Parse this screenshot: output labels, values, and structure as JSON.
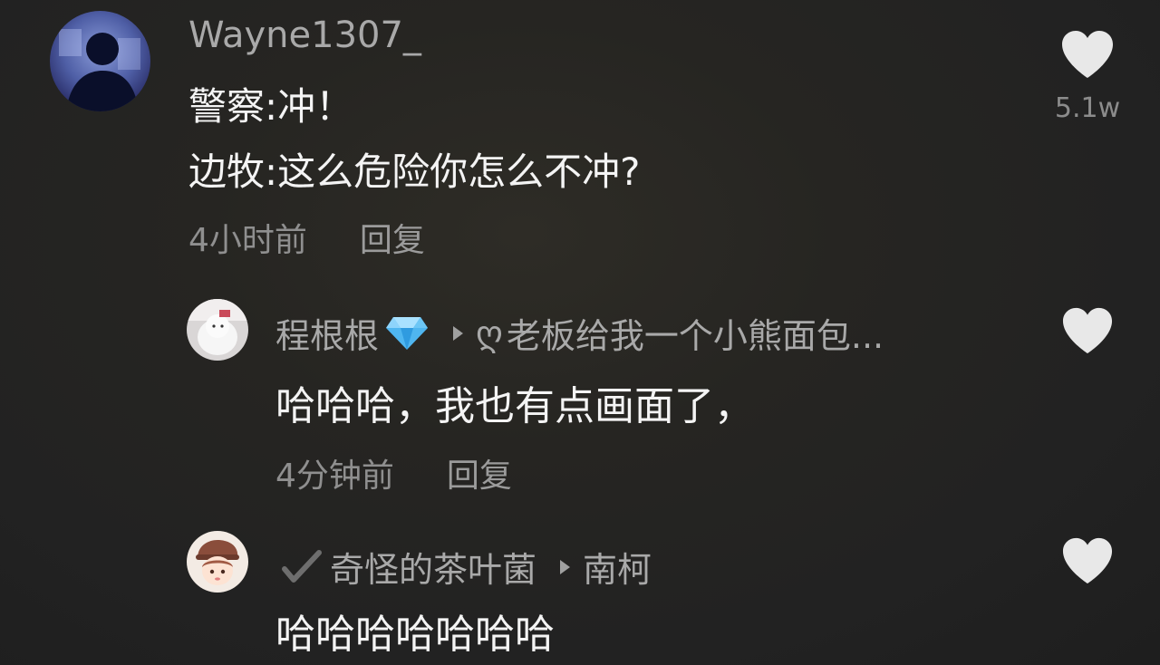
{
  "comments": [
    {
      "username": "Wayne1307_",
      "lines": [
        "警察:冲！",
        "边牧:这么危险你怎么不冲?"
      ],
      "time": "4小时前",
      "reply_label": "回复",
      "likes": "5.1w",
      "avatar_icon": "user-avatar-photo"
    },
    {
      "username": "程根根",
      "badge_icon": "diamond-icon",
      "reply_to_icon": "small-symbol-icon",
      "reply_to": "老板给我一个小熊面包...",
      "text": "哈哈哈，我也有点画面了，",
      "time": "4分钟前",
      "reply_label": "回复",
      "avatar_icon": "user-avatar-photo"
    },
    {
      "prefix_icon": "check-icon",
      "username": "奇怪的茶叶菌",
      "reply_to": "南柯",
      "text": "哈哈哈哈哈哈哈",
      "avatar_icon": "user-avatar-illustration"
    }
  ],
  "colors": {
    "background": "#232323",
    "text_primary": "#f4f4f4",
    "text_secondary": "#a9a9a9",
    "heart": "#e8e8e8",
    "diamond": "#4fb6f0"
  }
}
